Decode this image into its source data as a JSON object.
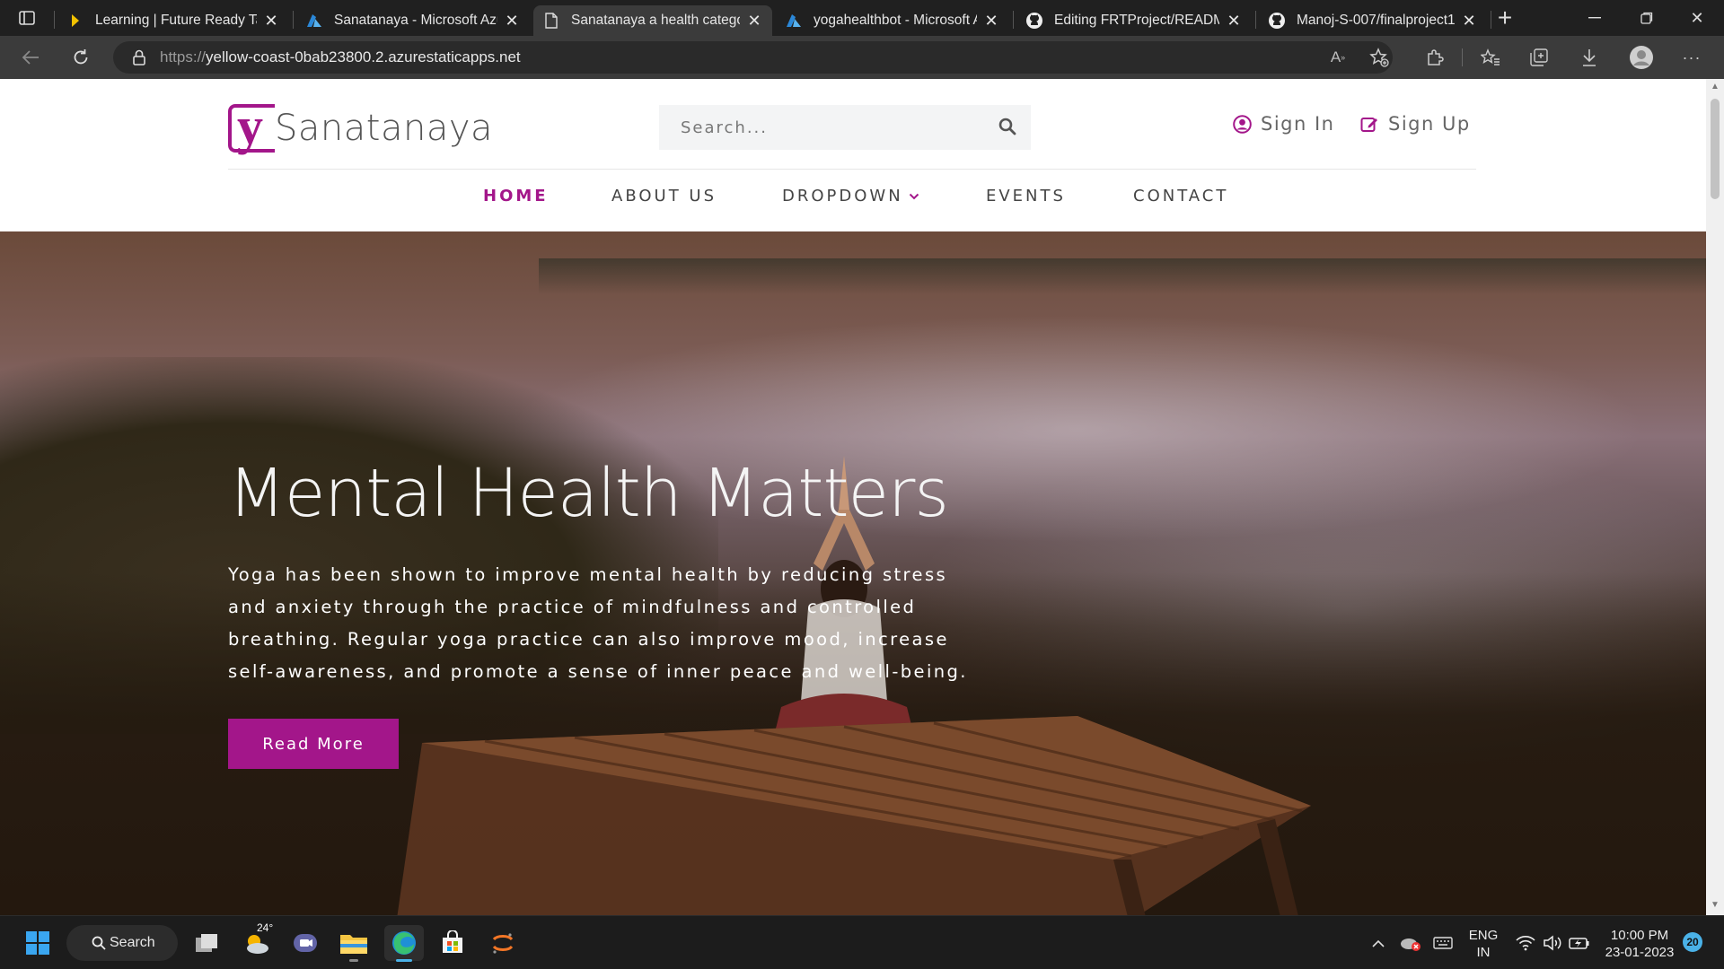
{
  "browser": {
    "tabs": [
      {
        "title": "Learning | Future Ready Tale",
        "icon": "play-favicon"
      },
      {
        "title": "Sanatanaya - Microsoft Azur",
        "icon": "azure-favicon"
      },
      {
        "title": "Sanatanaya a health catego",
        "icon": "page-favicon",
        "active": true
      },
      {
        "title": "yogahealthbot - Microsoft A",
        "icon": "azure-favicon"
      },
      {
        "title": "Editing FRTProject/README",
        "icon": "github-favicon"
      },
      {
        "title": "Manoj-S-007/finalproject1:",
        "icon": "github-favicon"
      }
    ],
    "url_scheme": "https://",
    "url_host": "yellow-coast-0bab23800.2.azurestaticapps.net"
  },
  "site": {
    "logo_text": "Sanatanaya",
    "logo_mark": "y",
    "search_placeholder": "Search...",
    "sign_in": "Sign In",
    "sign_up": "Sign Up",
    "nav": [
      {
        "label": "HOME",
        "active": true
      },
      {
        "label": "ABOUT US"
      },
      {
        "label": "DROPDOWN"
      },
      {
        "label": "EVENTS"
      },
      {
        "label": "CONTACT"
      }
    ],
    "hero": {
      "title": "Mental Health Matters",
      "text": "Yoga has been shown to improve mental health by reducing stress and anxiety through the practice of mindfulness and controlled breathing. Regular yoga practice can also improve mood, increase self-awareness, and promote a sense of inner peace and well-being.",
      "button": "Read More"
    },
    "accent_color": "#a3168a"
  },
  "taskbar": {
    "search_label": "Search",
    "weather_temp": "24°",
    "language_line1": "ENG",
    "language_line2": "IN",
    "time": "10:00 PM",
    "date": "23-01-2023",
    "notification_count": "20"
  }
}
